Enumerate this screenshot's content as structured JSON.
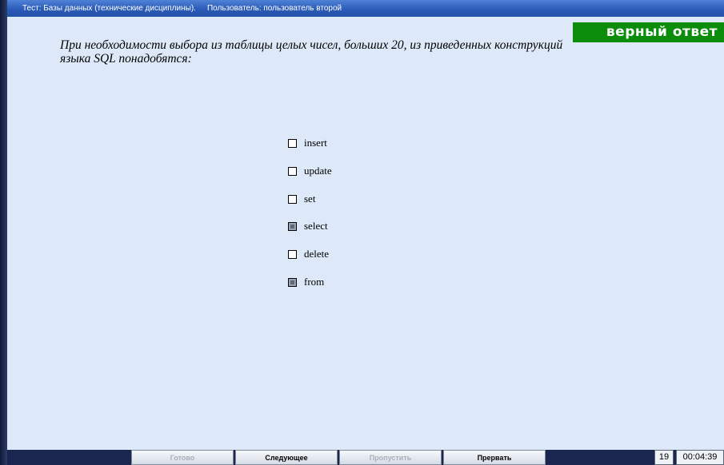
{
  "titlebar": {
    "test_label": "Тест: Базы данных (технические дисциплины).",
    "user_label": "Пользователь: пользователь второй"
  },
  "result_badge": "верный ответ",
  "question": {
    "line1": "При необходимости выбора из таблицы целых чисел, больших 20, из приведенных конструкций",
    "line2": "языка SQL понадобятся:"
  },
  "options": [
    {
      "label": "insert",
      "checked": false
    },
    {
      "label": "update",
      "checked": false
    },
    {
      "label": "set",
      "checked": false
    },
    {
      "label": "select",
      "checked": true
    },
    {
      "label": "delete",
      "checked": false
    },
    {
      "label": "from",
      "checked": true
    }
  ],
  "buttons": {
    "done": "Готово",
    "next": "Следующее",
    "skip": "Пропустить",
    "abort": "Прервать"
  },
  "status": {
    "question_number": "19",
    "timer": "00:04:39"
  }
}
